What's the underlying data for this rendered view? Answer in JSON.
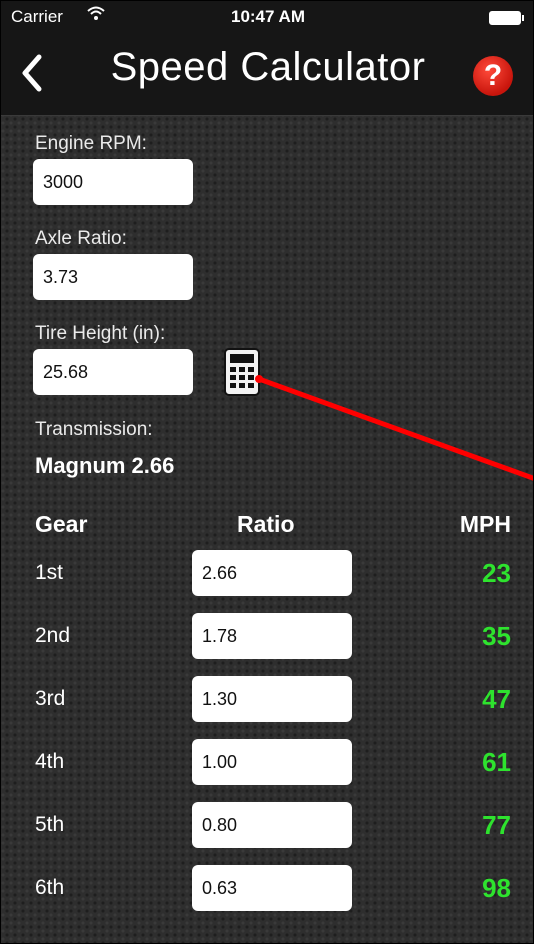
{
  "status_bar": {
    "carrier": "Carrier",
    "time": "10:47 AM"
  },
  "nav": {
    "back_icon": "chevron-left-icon",
    "title": "Speed Calculator",
    "help_label": "?"
  },
  "form": {
    "engine_rpm_label": "Engine RPM:",
    "engine_rpm_value": "3000",
    "axle_ratio_label": "Axle Ratio:",
    "axle_ratio_value": "3.73",
    "tire_height_label": "Tire Height (in):",
    "tire_height_value": "25.68",
    "calculator_icon": "calculator-icon",
    "transmission_label": "Transmission:",
    "transmission_value": "Magnum 2.66"
  },
  "table": {
    "headers": {
      "gear": "Gear",
      "ratio": "Ratio",
      "mph": "MPH"
    },
    "rows": [
      {
        "gear": "1st",
        "ratio": "2.66",
        "mph": "23"
      },
      {
        "gear": "2nd",
        "ratio": "1.78",
        "mph": "35"
      },
      {
        "gear": "3rd",
        "ratio": "1.30",
        "mph": "47"
      },
      {
        "gear": "4th",
        "ratio": "1.00",
        "mph": "61"
      },
      {
        "gear": "5th",
        "ratio": "0.80",
        "mph": "77"
      },
      {
        "gear": "6th",
        "ratio": "0.63",
        "mph": "98"
      }
    ]
  },
  "colors": {
    "mph_text": "#2ee32e",
    "help_button": "#d8251a",
    "annotation_arrow": "#ff0000"
  }
}
